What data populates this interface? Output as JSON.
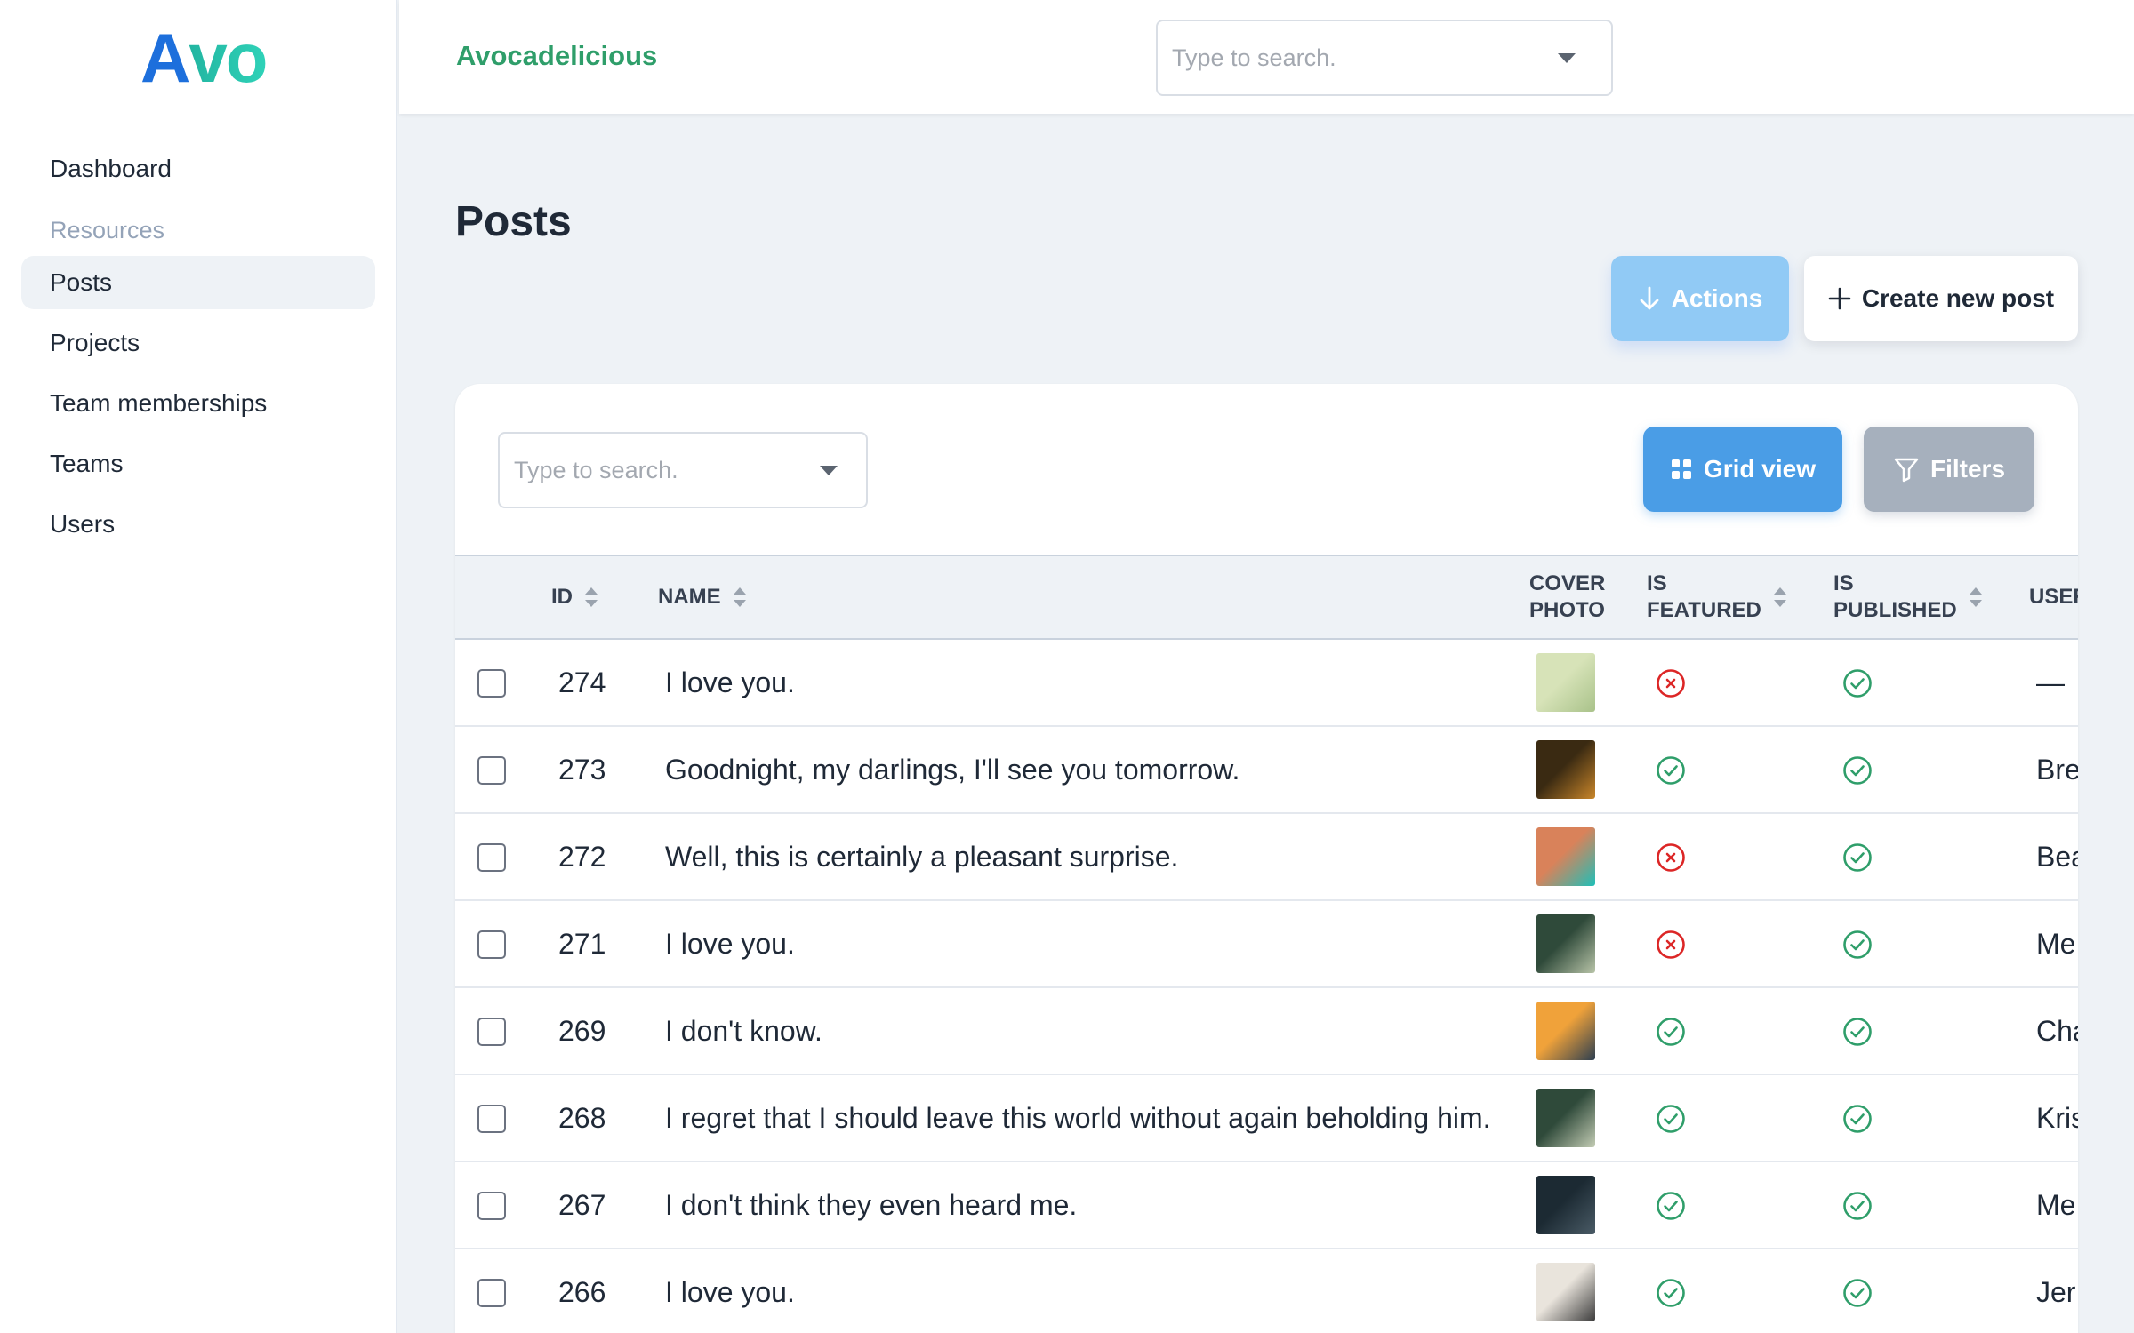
{
  "app": {
    "logo_a": "A",
    "logo_rest": "vo",
    "brand": "Avocadelicious",
    "global_search_placeholder": "Type to search."
  },
  "sidebar": {
    "dashboard": "Dashboard",
    "resources_heading": "Resources",
    "items": [
      {
        "label": "Posts",
        "active": true
      },
      {
        "label": "Projects",
        "active": false
      },
      {
        "label": "Team memberships",
        "active": false
      },
      {
        "label": "Teams",
        "active": false
      },
      {
        "label": "Users",
        "active": false
      }
    ]
  },
  "page": {
    "title": "Posts",
    "actions_label": "Actions",
    "create_label": "Create new post",
    "table_search_placeholder": "Type to search.",
    "grid_view_label": "Grid view",
    "filters_label": "Filters"
  },
  "table": {
    "columns": {
      "id": "ID",
      "name": "NAME",
      "cover_photo_1": "COVER",
      "cover_photo_2": "PHOTO",
      "is_featured_1": "IS",
      "is_featured_2": "FEATURED",
      "is_published_1": "IS",
      "is_published_2": "PUBLISHED",
      "user": "USER"
    },
    "rows": [
      {
        "id": "274",
        "name": "I love you.",
        "featured": false,
        "published": true,
        "user": "—",
        "thumb_a": "#d7e3b8",
        "thumb_b": "#a9c28a"
      },
      {
        "id": "273",
        "name": "Goodnight, my darlings, I'll see you tomorrow.",
        "featured": true,
        "published": true,
        "user": "Bre",
        "thumb_a": "#3a2a12",
        "thumb_b": "#c9862a"
      },
      {
        "id": "272",
        "name": "Well, this is certainly a pleasant surprise.",
        "featured": false,
        "published": true,
        "user": "Bea",
        "thumb_a": "#d9825a",
        "thumb_b": "#1fbfb8"
      },
      {
        "id": "271",
        "name": "I love you.",
        "featured": false,
        "published": true,
        "user": "Me",
        "thumb_a": "#2f4a3a",
        "thumb_b": "#b8c4a8"
      },
      {
        "id": "269",
        "name": "I don't know.",
        "featured": true,
        "published": true,
        "user": "Cha",
        "thumb_a": "#f0a23a",
        "thumb_b": "#2c3e50"
      },
      {
        "id": "268",
        "name": "I regret that I should leave this world without again beholding him.",
        "featured": true,
        "published": true,
        "user": "Kris",
        "thumb_a": "#2f4a3a",
        "thumb_b": "#c3ccb4"
      },
      {
        "id": "267",
        "name": "I don't think they even heard me.",
        "featured": true,
        "published": true,
        "user": "Me",
        "thumb_a": "#1c2a33",
        "thumb_b": "#4a5b66"
      },
      {
        "id": "266",
        "name": "I love you.",
        "featured": true,
        "published": true,
        "user": "Jer",
        "thumb_a": "#e9e4dc",
        "thumb_b": "#3b3b3b"
      }
    ]
  },
  "colors": {
    "brand_green": "#2f9e6a",
    "check_green": "#2f9e6a",
    "cross_red": "#dc2626",
    "primary_blue": "#4a9de6"
  }
}
